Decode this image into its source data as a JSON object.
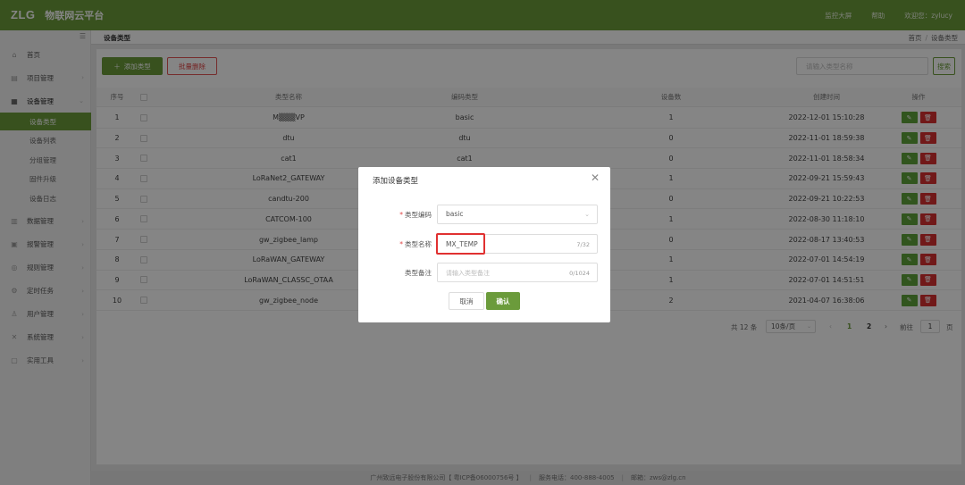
{
  "header": {
    "logo": "ZLG",
    "platform": "物联网云平台",
    "nav": [
      "监控大屏",
      "帮助",
      "欢迎您：zylucy"
    ]
  },
  "sidebar": {
    "items": [
      {
        "label": "首页",
        "icon": "home-icon",
        "glyph": "⌂",
        "has_children": false
      },
      {
        "label": "项目管理",
        "icon": "project-icon",
        "glyph": "▤",
        "has_children": true
      },
      {
        "label": "设备管理",
        "icon": "device-icon",
        "glyph": "▦",
        "has_children": true,
        "open": true,
        "children": [
          "设备类型",
          "设备列表",
          "分组管理",
          "固件升级",
          "设备日志"
        ]
      },
      {
        "label": "数据管理",
        "icon": "data-icon",
        "glyph": "▥",
        "has_children": true
      },
      {
        "label": "报警管理",
        "icon": "alarm-icon",
        "glyph": "▣",
        "has_children": true
      },
      {
        "label": "规则管理",
        "icon": "rule-icon",
        "glyph": "◎",
        "has_children": true
      },
      {
        "label": "定时任务",
        "icon": "timer-icon",
        "glyph": "⚙",
        "has_children": true
      },
      {
        "label": "用户管理",
        "icon": "user-icon",
        "glyph": "♙",
        "has_children": true
      },
      {
        "label": "系统管理",
        "icon": "system-icon",
        "glyph": "✕",
        "has_children": true
      },
      {
        "label": "实用工具",
        "icon": "tools-icon",
        "glyph": "▢",
        "has_children": true
      }
    ],
    "active_child": "设备类型"
  },
  "breadcrumb": {
    "title": "设备类型",
    "path": [
      "首页",
      "设备类型"
    ]
  },
  "toolbar": {
    "add_label": "添加类型",
    "batch_delete_label": "批量删除",
    "search_placeholder": "请输入类型名称",
    "search_label": "搜索"
  },
  "table": {
    "columns": [
      "序号",
      "类型名称",
      "编码类型",
      "设备数",
      "创建时间",
      "操作"
    ],
    "rows": [
      {
        "idx": "1",
        "name": "M▒▒▒VP",
        "code": "basic",
        "count": "1",
        "time": "2022-12-01 15:10:28"
      },
      {
        "idx": "2",
        "name": "dtu",
        "code": "dtu",
        "count": "0",
        "time": "2022-11-01 18:59:38"
      },
      {
        "idx": "3",
        "name": "cat1",
        "code": "cat1",
        "count": "0",
        "time": "2022-11-01 18:58:34"
      },
      {
        "idx": "4",
        "name": "LoRaNet2_GATEWAY",
        "code": "",
        "count": "1",
        "time": "2022-09-21 15:59:43"
      },
      {
        "idx": "5",
        "name": "candtu-200",
        "code": "",
        "count": "0",
        "time": "2022-09-21 10:22:53"
      },
      {
        "idx": "6",
        "name": "CATCOM-100",
        "code": "",
        "count": "1",
        "time": "2022-08-30 11:18:10"
      },
      {
        "idx": "7",
        "name": "gw_zigbee_lamp",
        "code": "",
        "count": "0",
        "time": "2022-08-17 13:40:53"
      },
      {
        "idx": "8",
        "name": "LoRaWAN_GATEWAY",
        "code": "",
        "count": "1",
        "time": "2022-07-01 14:54:19"
      },
      {
        "idx": "9",
        "name": "LoRaWAN_CLASSC_OTAA",
        "code": "",
        "count": "1",
        "time": "2022-07-01 14:51:51"
      },
      {
        "idx": "10",
        "name": "gw_zigbee_node",
        "code": "",
        "count": "2",
        "time": "2021-04-07 16:38:06"
      }
    ],
    "edit_glyph": "✎",
    "delete_glyph": "🗑"
  },
  "pagination": {
    "total": "共 12 条",
    "page_size": "10条/页",
    "pages": [
      "1",
      "2"
    ],
    "current": "1",
    "goto_label": "前往",
    "goto_value": "1",
    "unit": "页"
  },
  "footer": {
    "company": "广州致远电子股份有限公司【 粤ICP备06000756号 】",
    "phone": "服务电话：400-888-4005",
    "email": "邮箱：zws@zlg.cn"
  },
  "dialog": {
    "title": "添加设备类型",
    "fields": {
      "code_type": {
        "label": "类型编码",
        "value": "basic",
        "required": true
      },
      "type_name": {
        "label": "类型名称",
        "value": "MX_TEMP",
        "counter": "7/32",
        "required": true
      },
      "remark": {
        "label": "类型备注",
        "placeholder": "请输入类型备注",
        "counter": "0/1024",
        "required": false
      }
    },
    "cancel_label": "取消",
    "ok_label": "确认"
  },
  "colors": {
    "brand_green": "#6b9b3b",
    "danger_red": "#d93030",
    "highlight_red": "#e03030"
  }
}
